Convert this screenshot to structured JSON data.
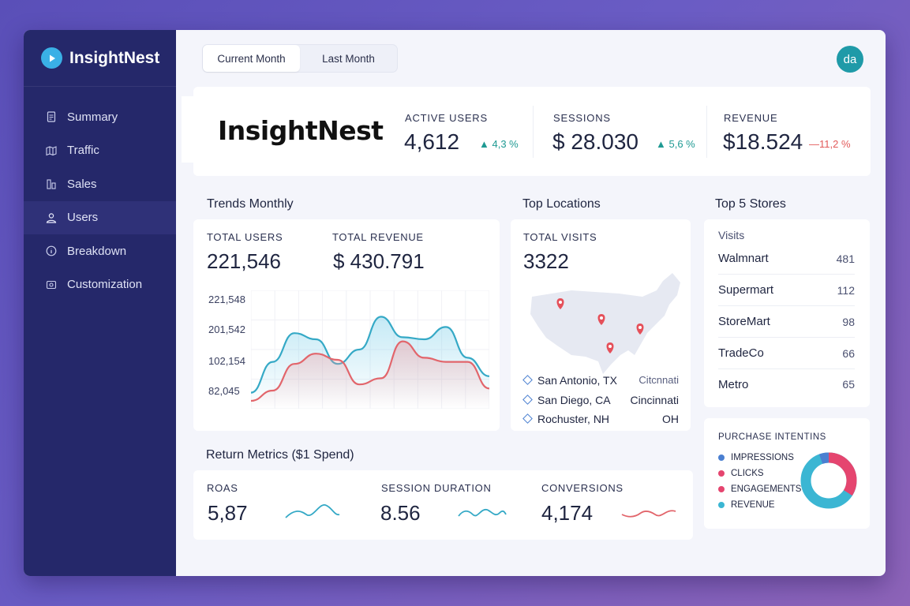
{
  "app": {
    "name": "InsightNest",
    "avatar_initials": "da"
  },
  "sidebar": {
    "items": [
      {
        "label": "Summary",
        "icon": "document-icon"
      },
      {
        "label": "Traffic",
        "icon": "map-icon"
      },
      {
        "label": "Sales",
        "icon": "bar-chart-icon"
      },
      {
        "label": "Users",
        "icon": "user-icon",
        "active": true
      },
      {
        "label": "Breakdown",
        "icon": "info-icon"
      },
      {
        "label": "Customization",
        "icon": "settings-icon"
      }
    ]
  },
  "tabs": [
    {
      "label": "Current Month",
      "active": true
    },
    {
      "label": "Last Month"
    }
  ],
  "kpis": {
    "brand": "InsightNest",
    "active_users": {
      "label": "ACTIVE USERS",
      "value": "4,612",
      "delta": "4,3 %"
    },
    "sessions": {
      "label": "SESSIONS",
      "value": "$ 28.030",
      "delta": "5,6 %"
    },
    "revenue": {
      "label": "REVENUE",
      "value": "$18.524",
      "delta": "11,2 %"
    }
  },
  "trends": {
    "title": "Trends Monthly",
    "total_users_label": "TOTAL USERS",
    "total_users_value": "221,546",
    "total_revenue_label": "TOTAL REVENUE",
    "total_revenue_value": "$ 430.791",
    "y_ticks": [
      "221,548",
      "201,542",
      "102,154",
      "82,045"
    ]
  },
  "chart_data": {
    "type": "line",
    "title": "Trends Monthly",
    "xlabel": "",
    "ylabel": "",
    "y_tick_labels": [
      "221,548",
      "201,542",
      "102,154",
      "82,045"
    ],
    "grid": true,
    "legend": "none",
    "series": [
      {
        "color": "#35a9c6",
        "values": [
          0.08,
          0.38,
          0.66,
          0.6,
          0.36,
          0.5,
          0.82,
          0.62,
          0.6,
          0.72,
          0.42,
          0.24
        ]
      },
      {
        "color": "#e2656b",
        "values": [
          0.0,
          0.1,
          0.36,
          0.46,
          0.4,
          0.16,
          0.22,
          0.58,
          0.42,
          0.38,
          0.38,
          0.12
        ]
      }
    ]
  },
  "locations": {
    "title": "Top Locations",
    "total_visits_label": "TOTAL VISITS",
    "total_visits_value": "3322",
    "rows": [
      {
        "left": "San Antonio, TX",
        "right": "Citcnnati"
      },
      {
        "left": "San Diego, CA",
        "right": "Cincinnati"
      },
      {
        "left": "Rochuster, NH",
        "right": "OH"
      }
    ]
  },
  "stores": {
    "title": "Top 5 Stores",
    "subtitle": "Visits",
    "rows": [
      {
        "name": "Walmnart",
        "count": "481"
      },
      {
        "name": "Supermart",
        "count": "112"
      },
      {
        "name": "StoreMart",
        "count": "98"
      },
      {
        "name": "TradeCo",
        "count": "66"
      },
      {
        "name": "Metro",
        "count": "65"
      }
    ]
  },
  "return_metrics": {
    "title": "Return Metrics ($1 Spend)",
    "roas_label": "ROAS",
    "roas_value": "5,87",
    "session_label": "SESSION DURATION",
    "session_value": "8.56",
    "conv_label": "CONVERSIONS",
    "conv_value": "4,174"
  },
  "purchase": {
    "title": "PURCHASE INTENTINS",
    "legend": [
      {
        "label": "IMPRESSIONS",
        "color": "#4a7fd1"
      },
      {
        "label": "CLICKS",
        "color": "#e5456f"
      },
      {
        "label": "ENGAGEMENTS",
        "color": "#e5456f"
      },
      {
        "label": "REVENUE",
        "color": "#3bb6d3"
      }
    ]
  },
  "colors": {
    "sidebar": "#25286a",
    "accent_teal": "#1f9a93",
    "accent_red": "#e25a5a"
  }
}
